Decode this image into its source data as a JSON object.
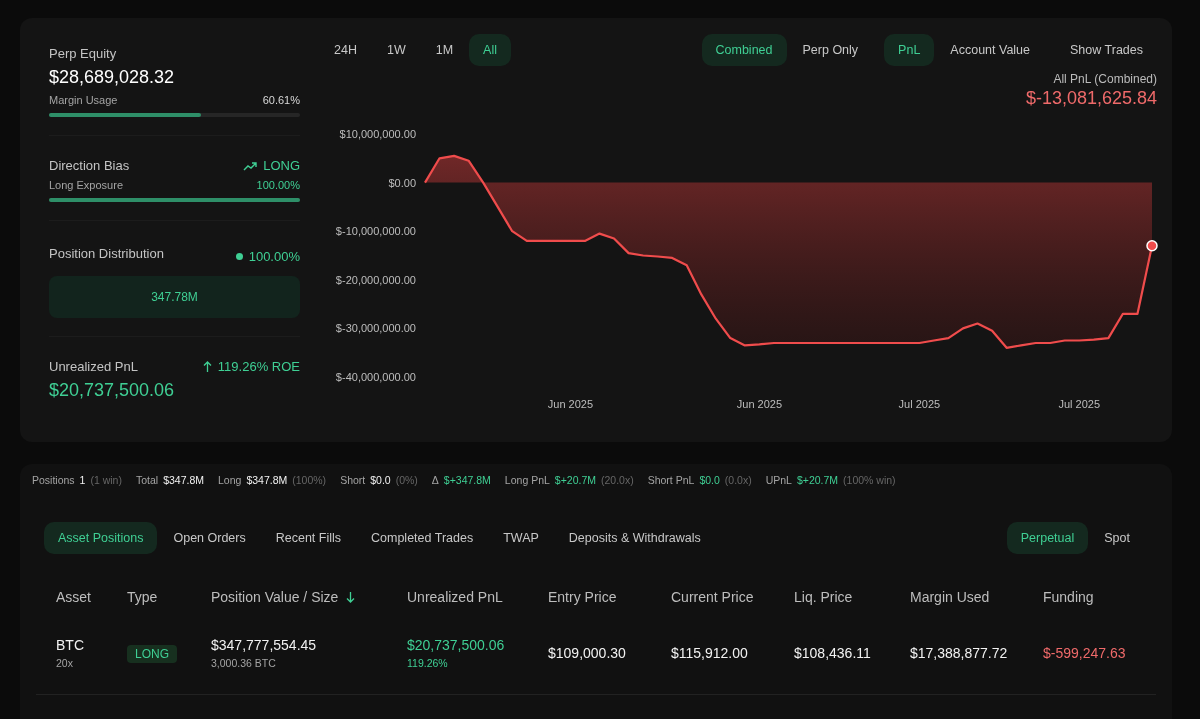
{
  "summary": {
    "perp_equity": {
      "label": "Perp Equity",
      "value": "$28,689,028.32"
    },
    "margin_usage": {
      "label": "Margin Usage",
      "value": "60.61%",
      "level": 0.6061
    },
    "direction_bias": {
      "label": "Direction Bias",
      "value": "LONG"
    },
    "long_exposure": {
      "label": "Long Exposure",
      "value": "100.00%",
      "level": 1.0
    },
    "position_distribution": {
      "label": "Position Distribution",
      "value": "100.00%",
      "bar": "347.78M"
    },
    "unrealized_pnl": {
      "label": "Unrealized PnL",
      "roe": "119.26% ROE",
      "value": "$20,737,500.06"
    }
  },
  "range_tabs": [
    {
      "label": "24H",
      "selected": false
    },
    {
      "label": "1W",
      "selected": false
    },
    {
      "label": "1M",
      "selected": false
    },
    {
      "label": "All",
      "selected": true
    }
  ],
  "mode_tabs": [
    {
      "label": "Combined",
      "selected": true
    },
    {
      "label": "Perp Only",
      "selected": false
    }
  ],
  "metric_tabs": [
    {
      "label": "PnL",
      "selected": true
    },
    {
      "label": "Account Value",
      "selected": false
    }
  ],
  "show_trades": "Show Trades",
  "pnl_title": "All PnL (Combined)",
  "pnl_value": "$-13,081,625.84",
  "chart_data": {
    "type": "area",
    "ylim": [
      -40000000,
      10000000
    ],
    "yticks": [
      {
        "value": 10000000,
        "label": "$10,000,000.00"
      },
      {
        "value": 0,
        "label": "$0.00"
      },
      {
        "value": -10000000,
        "label": "$-10,000,000.00"
      },
      {
        "value": -20000000,
        "label": "$-20,000,000.00"
      },
      {
        "value": -30000000,
        "label": "$-30,000,000.00"
      },
      {
        "value": -40000000,
        "label": "$-40,000,000.00"
      }
    ],
    "categories": [
      null,
      null,
      null,
      null,
      null,
      null,
      null,
      null,
      null,
      null,
      "Jun 2025",
      null,
      null,
      null,
      null,
      null,
      null,
      null,
      null,
      null,
      null,
      null,
      null,
      "Jun 2025",
      null,
      null,
      null,
      null,
      null,
      null,
      null,
      null,
      null,
      null,
      "Jul 2025",
      null,
      null,
      null,
      null,
      null,
      null,
      null,
      null,
      null,
      null,
      "Jul 2025",
      null,
      null,
      null,
      null,
      null
    ],
    "series": [
      {
        "color": "#f04c4c",
        "values": [
          0,
          5000000,
          5500000,
          4500000,
          0,
          -5000000,
          -10000000,
          -12000000,
          -12000000,
          -12000000,
          -12000000,
          -12000000,
          -10500000,
          -11500000,
          -14500000,
          -15000000,
          -15200000,
          -15500000,
          -17000000,
          -23000000,
          -28000000,
          -32000000,
          -33500000,
          -33300000,
          -33000000,
          -33000000,
          -33000000,
          -33000000,
          -33000000,
          -33000000,
          -33000000,
          -33000000,
          -33000000,
          -33000000,
          -33000000,
          -32500000,
          -32000000,
          -30000000,
          -29000000,
          -30500000,
          -34000000,
          -33500000,
          -33000000,
          -33000000,
          -32500000,
          -32500000,
          -32300000,
          -32000000,
          -27000000,
          -27000000,
          -13000000
        ]
      }
    ]
  },
  "stats": [
    {
      "label": "Positions",
      "value": "1",
      "note": "(1 win)",
      "kind": "neutral"
    },
    {
      "label": "Total",
      "value": "$347.8M",
      "kind": "neutral"
    },
    {
      "label": "Long",
      "value": "$347.8M",
      "note": "(100%)",
      "kind": "neutral"
    },
    {
      "label": "Short",
      "value": "$0.0",
      "note": "(0%)",
      "kind": "neutral"
    },
    {
      "label": "Δ",
      "value": "$+347.8M",
      "kind": "positive"
    },
    {
      "label": "Long PnL",
      "value": "$+20.7M",
      "note": "(20.0x)",
      "kind": "positive"
    },
    {
      "label": "Short PnL",
      "value": "$0.0",
      "note": "(0.0x)",
      "kind": "positive"
    },
    {
      "label": "UPnL",
      "value": "$+20.7M",
      "note": "(100% win)",
      "kind": "positive"
    }
  ],
  "position_tabs": [
    {
      "label": "Asset Positions",
      "selected": true
    },
    {
      "label": "Open Orders",
      "selected": false
    },
    {
      "label": "Recent Fills",
      "selected": false
    },
    {
      "label": "Completed Trades",
      "selected": false
    },
    {
      "label": "TWAP",
      "selected": false
    },
    {
      "label": "Deposits & Withdrawals",
      "selected": false
    }
  ],
  "market_tabs": [
    {
      "label": "Perpetual",
      "selected": true
    },
    {
      "label": "Spot",
      "selected": false
    }
  ],
  "table": {
    "columns": [
      {
        "label": "Asset",
        "sorted": false
      },
      {
        "label": "Type",
        "sorted": false
      },
      {
        "label": "Position Value / Size",
        "sorted": true
      },
      {
        "label": "Unrealized PnL",
        "sorted": false
      },
      {
        "label": "Entry Price",
        "sorted": false
      },
      {
        "label": "Current Price",
        "sorted": false
      },
      {
        "label": "Liq. Price",
        "sorted": false
      },
      {
        "label": "Margin Used",
        "sorted": false
      },
      {
        "label": "Funding",
        "sorted": false
      }
    ],
    "rows": [
      {
        "asset": "BTC",
        "leverage": "20x",
        "type": "LONG",
        "value": "$347,777,554.45",
        "size": "3,000.36 BTC",
        "upnl": "$20,737,500.06",
        "upnl_pct": "119.26%",
        "entry": "$109,000.30",
        "current": "$115,912.00",
        "liq": "$108,436.11",
        "margin": "$17,388,877.72",
        "funding": "$-599,247.63"
      }
    ]
  }
}
